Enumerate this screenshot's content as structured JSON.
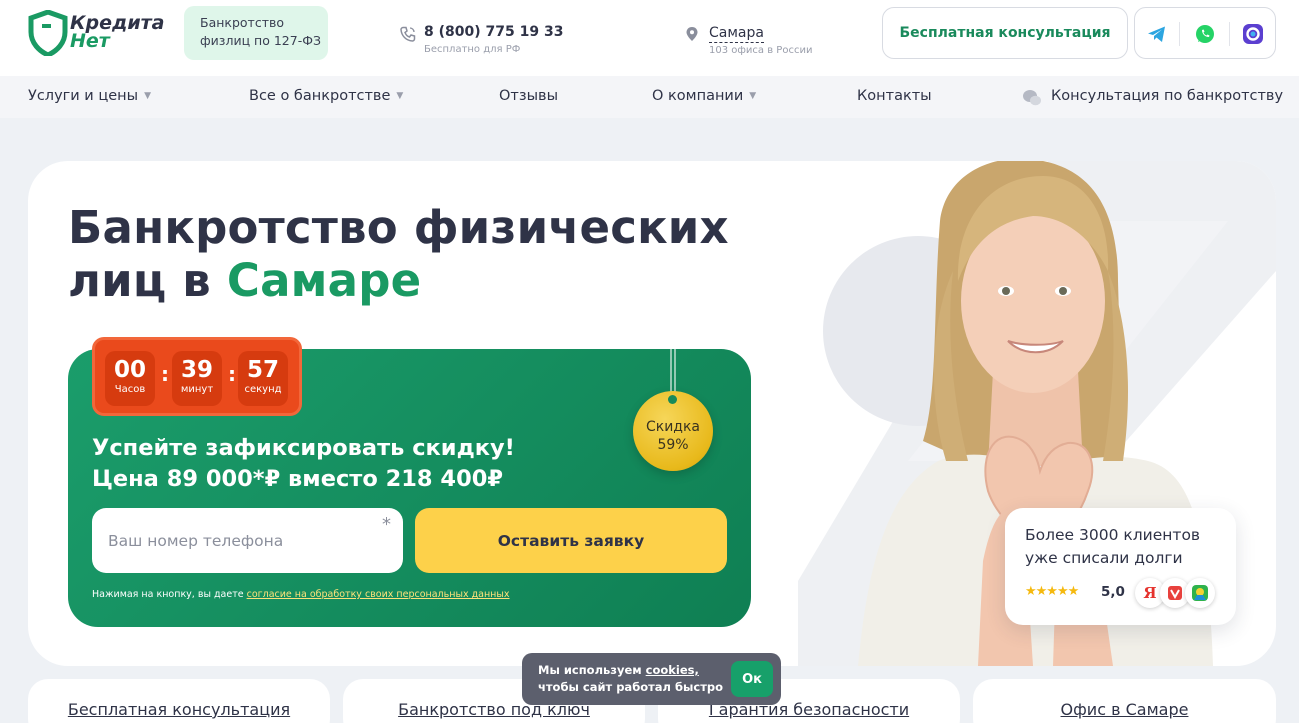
{
  "header": {
    "logo": {
      "line1": "Кредита",
      "line2": "Нет"
    },
    "tagline": [
      "Банкротство",
      "физлиц по 127-ФЗ"
    ],
    "phone": {
      "number": "8 (800) 775 19 33",
      "note": "Бесплатно для РФ"
    },
    "city": {
      "name": "Самара",
      "note": "103 офиса в России"
    },
    "consult_button": "Бесплатная консультация",
    "messengers": [
      "telegram-icon",
      "whatsapp-icon",
      "max-messenger-icon"
    ]
  },
  "nav": {
    "items": [
      {
        "label": "Услуги и цены",
        "has_dropdown": true
      },
      {
        "label": "Все о банкротстве",
        "has_dropdown": true
      },
      {
        "label": "Отзывы",
        "has_dropdown": false
      },
      {
        "label": "О компании",
        "has_dropdown": true
      },
      {
        "label": "Контакты",
        "has_dropdown": false
      },
      {
        "label": "Консультация по банкротству",
        "has_dropdown": false
      }
    ]
  },
  "hero": {
    "title_part1": "Банкротство физических",
    "title_part2": "лиц в ",
    "title_accent": "Самаре"
  },
  "timer": {
    "hours": "00",
    "hours_label": "Часов",
    "minutes": "39",
    "minutes_label": "минут",
    "seconds": "57",
    "seconds_label": "секунд"
  },
  "offer": {
    "line1": "Успейте зафиксировать скидку!",
    "line2": "Цена 89 000*₽ вместо 218 400₽",
    "tag_label": "Скидка",
    "tag_value": "59%",
    "phone_placeholder": "Ваш номер телефона",
    "required_mark": "*",
    "submit": "Оставить заявку",
    "consent_prefix": "Нажимая на кнопку, вы даете ",
    "consent_link": "согласие на обработку своих персональных данных"
  },
  "reviews": {
    "text_line1": "Более 3000 клиентов",
    "text_line2": "уже списали долги",
    "stars": "★★★★★",
    "rating": "5,0",
    "sources": [
      "yandex-icon",
      "vk-icon",
      "2gis-icon"
    ]
  },
  "bottom_cards": [
    "Бесплатная консультация",
    "Банкротство под ключ",
    "Гарантия безопасности",
    "Офис в Самаре"
  ],
  "cookie": {
    "prefix": "Мы используем ",
    "link": "cookies,",
    "line2": "чтобы сайт работал быстро",
    "button": "Ок"
  },
  "colors": {
    "brand_green": "#1a9a63",
    "dark_text": "#2f3347",
    "timer_orange": "#ea4a1c",
    "cta_yellow": "#fdd14a"
  }
}
